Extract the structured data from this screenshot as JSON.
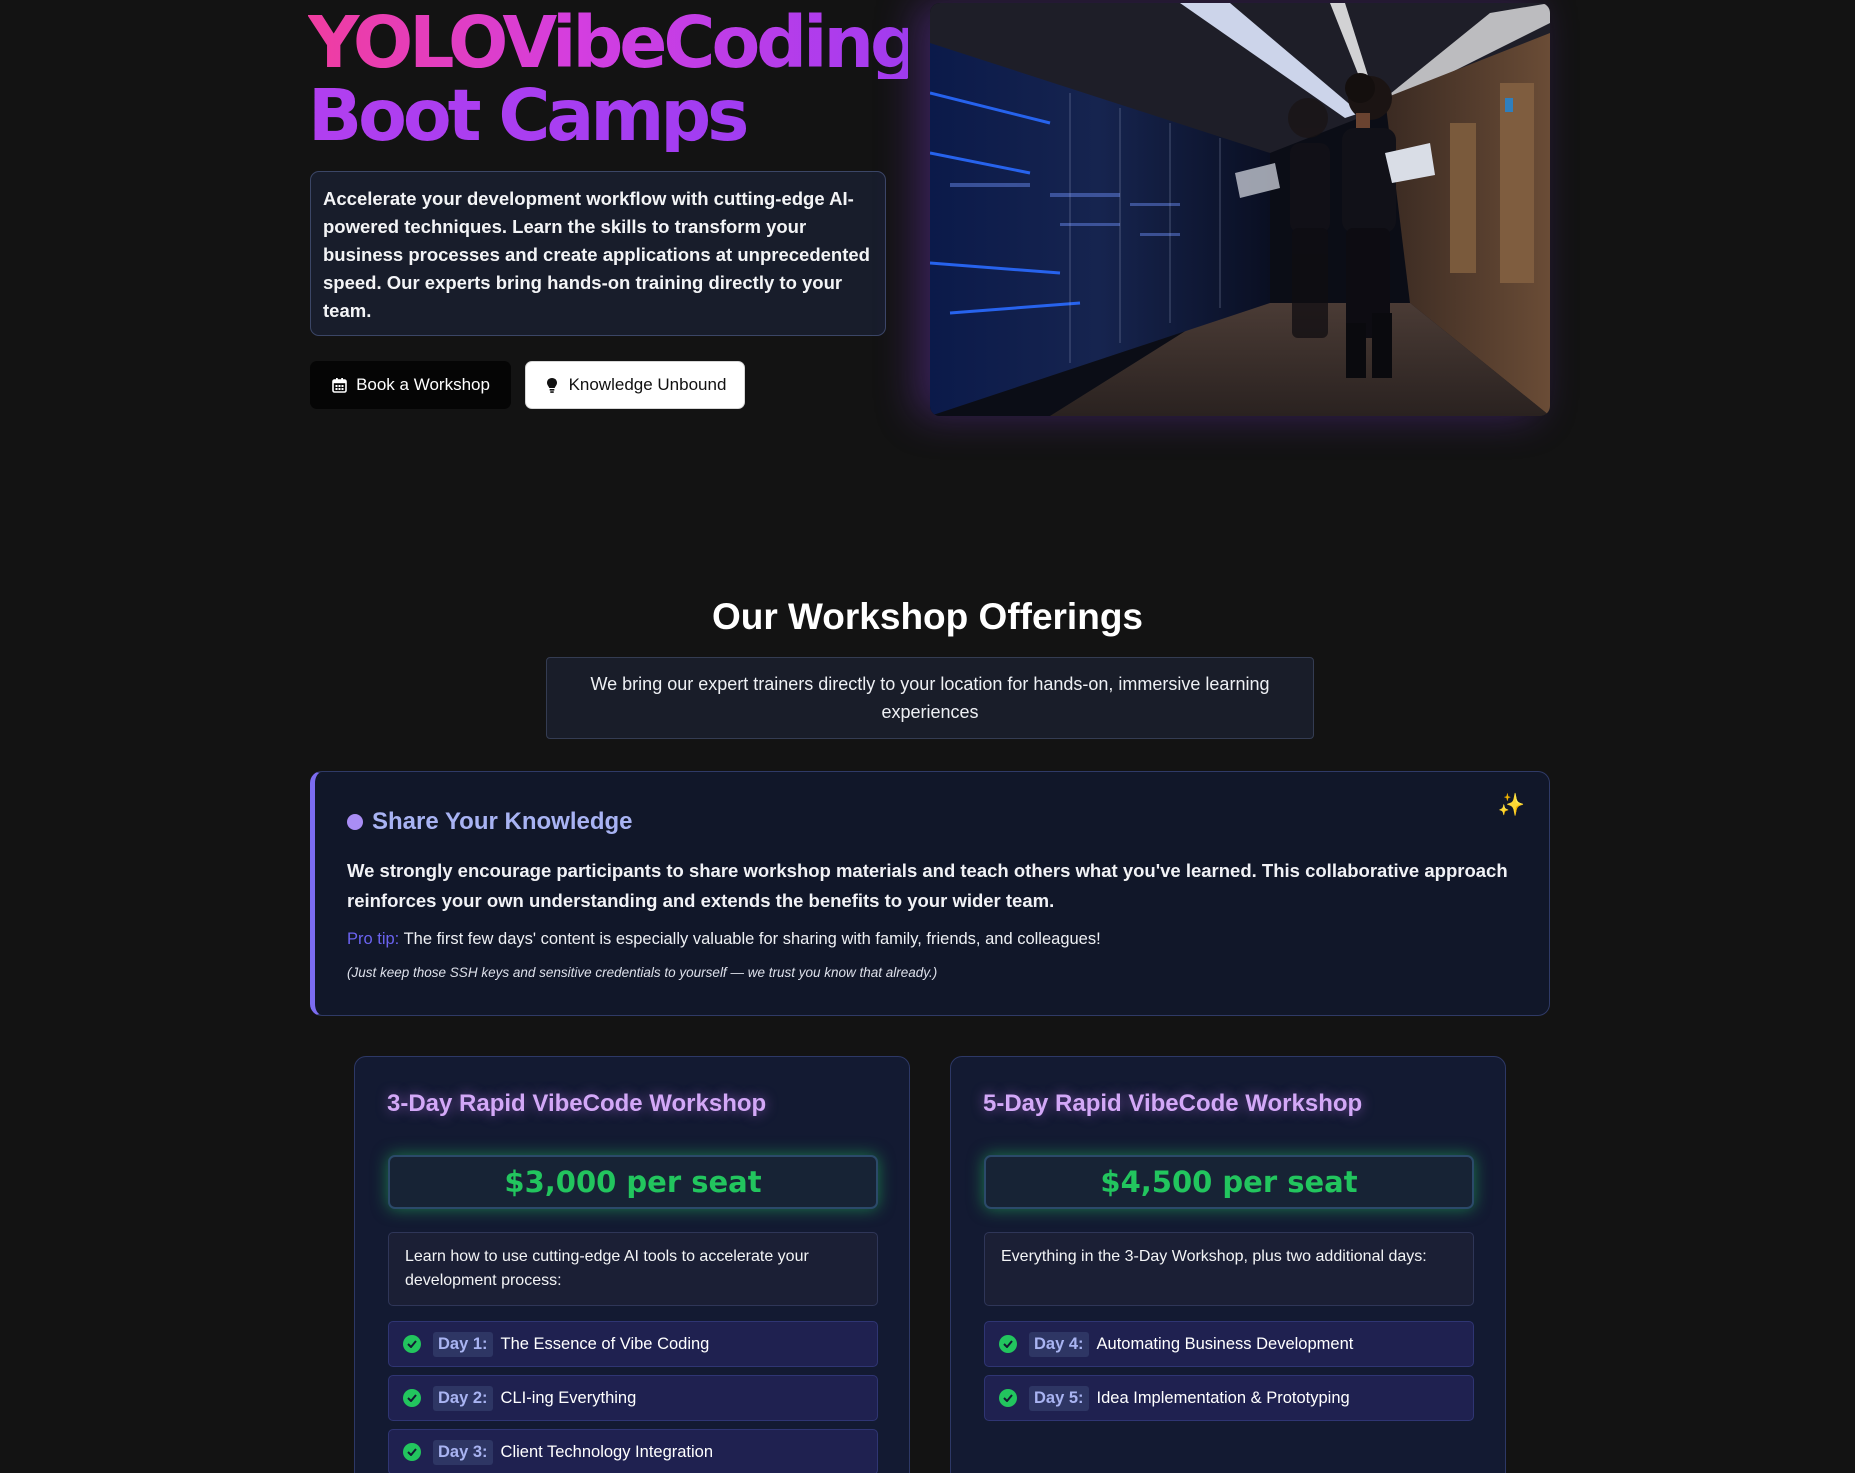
{
  "hero": {
    "title_line1": "YOLOVibeCoding",
    "title_line2": "Boot Camps",
    "description": "Accelerate your development workflow with cutting-edge AI-powered techniques. Learn the skills to transform your business processes and create applications at unprecedented speed. Our experts bring hands-on training directly to your team.",
    "buttons": {
      "book_label": "Book a Workshop",
      "knowledge_label": "Knowledge Unbound"
    }
  },
  "offerings": {
    "title": "Our Workshop Offerings",
    "subtitle": "We bring our expert trainers directly to your location for hands-on, immersive learning experiences"
  },
  "share": {
    "title": "Share Your Knowledge",
    "sparkle": "✨",
    "body": "We strongly encourage participants to share workshop materials and teach others what you've learned. This collaborative approach reinforces your own understanding and extends the benefits to your wider team.",
    "tip_label": "Pro tip:",
    "tip_text": "The first few days' content is especially valuable for sharing with family, friends, and colleagues!",
    "note": "(Just keep those SSH keys and sensitive credentials to yourself — we trust you know that already.)"
  },
  "workshops": [
    {
      "title": "3-Day Rapid VibeCode Workshop",
      "price": "$3,000 per seat",
      "description": "Learn how to use cutting-edge AI tools to accelerate your development process:",
      "days": [
        {
          "label": "Day 1:",
          "text": "The Essence of Vibe Coding"
        },
        {
          "label": "Day 2:",
          "text": "CLI-ing Everything"
        },
        {
          "label": "Day 3:",
          "text": "Client Technology Integration"
        }
      ]
    },
    {
      "title": "5-Day Rapid VibeCode Workshop",
      "price": "$4,500 per seat",
      "description": "Everything in the 3-Day Workshop, plus two additional days:",
      "days": [
        {
          "label": "Day 4:",
          "text": "Automating Business Development"
        },
        {
          "label": "Day 5:",
          "text": "Idea Implementation & Prototyping"
        }
      ]
    }
  ],
  "colors": {
    "background": "#131313",
    "title_gradient_start": "#f03da0",
    "title_gradient_end": "#a23cf0",
    "price_green": "#22c55e",
    "card_title": "#d3a8f7",
    "accent_indigo": "#7c6cf0"
  },
  "icons": {
    "book_button": "calendar-icon",
    "knowledge_button": "lightbulb-icon",
    "day_item": "check-circle-icon",
    "share_heading": "dot-icon",
    "share_corner": "sparkle-icon"
  }
}
